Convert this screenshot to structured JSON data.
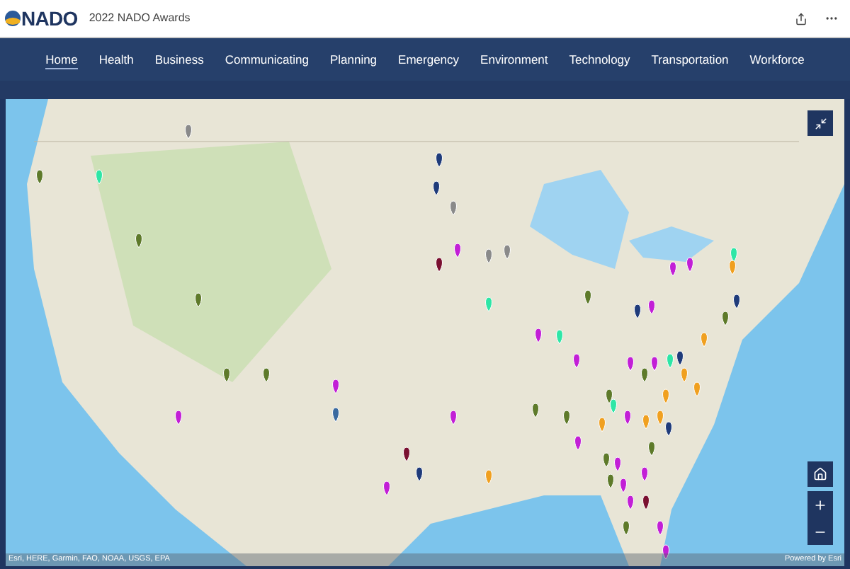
{
  "header": {
    "logo": "NADO",
    "title": "2022 NADO Awards"
  },
  "nav": [
    {
      "label": "Home",
      "selected": true
    },
    {
      "label": "Health",
      "selected": false
    },
    {
      "label": "Business",
      "selected": false
    },
    {
      "label": "Communicating",
      "selected": false
    },
    {
      "label": "Planning",
      "selected": false
    },
    {
      "label": "Emergency",
      "selected": false
    },
    {
      "label": "Environment",
      "selected": false
    },
    {
      "label": "Technology",
      "selected": false
    },
    {
      "label": "Transportation",
      "selected": false
    },
    {
      "label": "Workforce",
      "selected": false
    }
  ],
  "map": {
    "attribution": "Esri, HERE, Garmin, FAO, NOAA, USGS, EPA",
    "powered_by": "Powered by Esri"
  }
}
